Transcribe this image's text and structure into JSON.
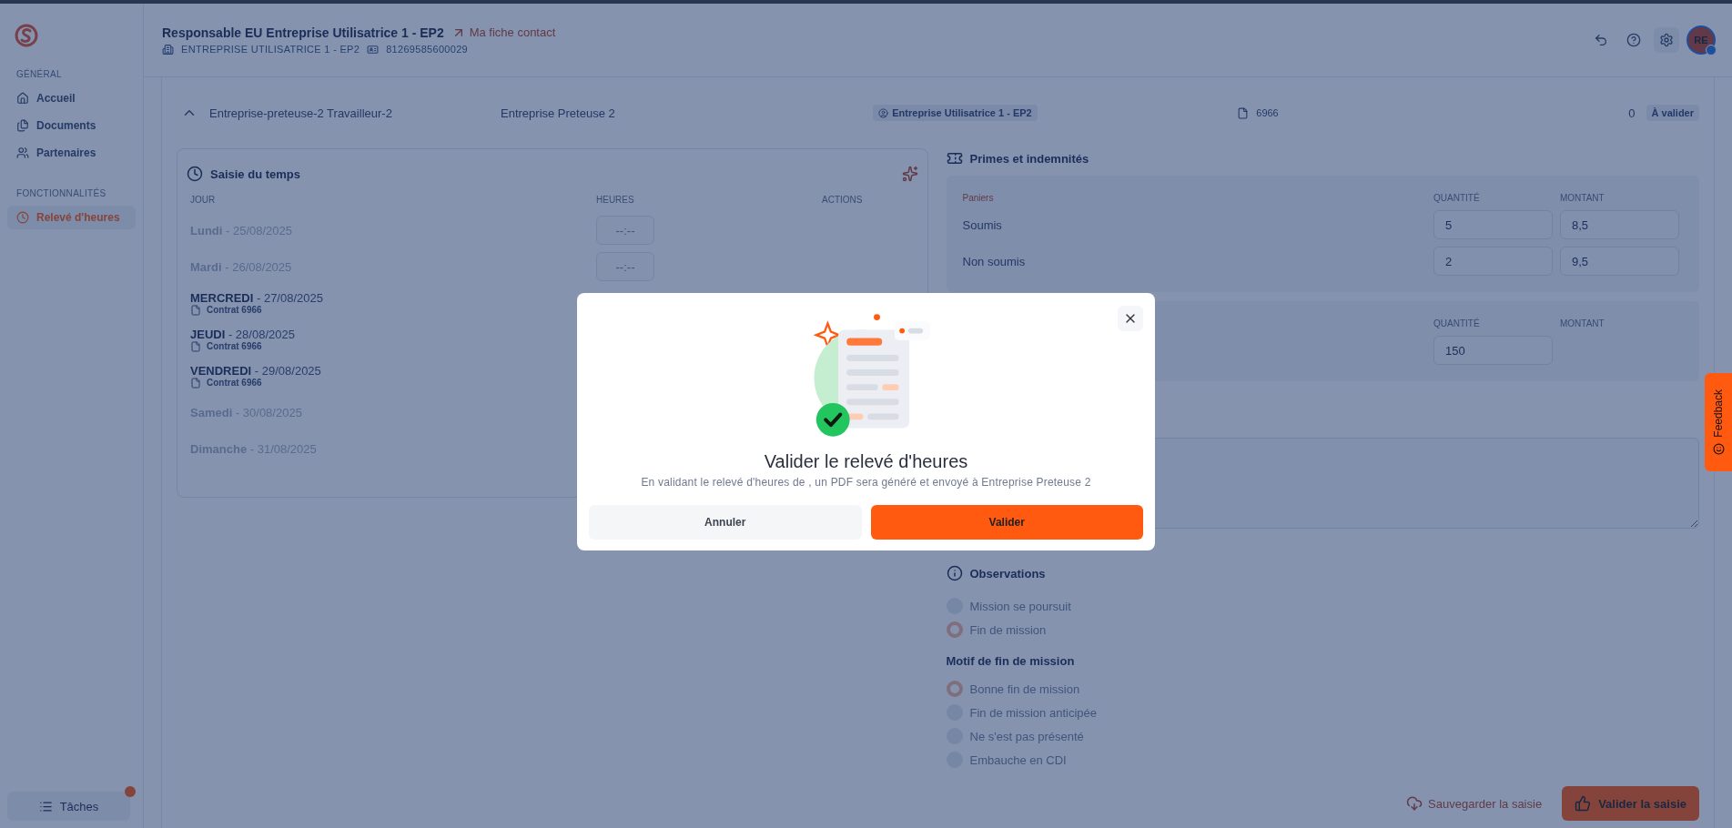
{
  "sidebar": {
    "sections": [
      {
        "title": "GÉNÉRAL",
        "items": [
          {
            "label": "Accueil",
            "selected": false
          },
          {
            "label": "Documents",
            "selected": false
          },
          {
            "label": "Partenaires",
            "selected": false
          }
        ]
      },
      {
        "title": "FONCTIONNALITÉS",
        "items": [
          {
            "label": "Relevé d'heures",
            "selected": true
          }
        ]
      }
    ],
    "tasks": {
      "label": "Tâches",
      "notification": true
    }
  },
  "header": {
    "title": "Responsable EU Entreprise Utilisatrice 1 - EP2",
    "contact_link": "Ma fiche contact",
    "company": "ENTREPRISE UTILISATRICE 1 - EP2",
    "siret": "81269585600029",
    "avatar": "RE"
  },
  "timesheet_row": {
    "expanded": true,
    "worker": "Entreprise-preteuse-2 Travailleur-2",
    "agency": "Entreprise Preteuse 2",
    "client": "Entreprise Utilisatrice 1 - EP2",
    "contract": "6966",
    "count": "0",
    "status": "À valider"
  },
  "time_entry": {
    "title": "Saisie du temps",
    "columns": [
      "JOUR",
      "HEURES",
      "ACTIONS"
    ],
    "days": [
      {
        "day": "Lundi",
        "date": "- 25/08/2025",
        "disabled": true,
        "hours_placeholder": "--:--"
      },
      {
        "day": "Mardi",
        "date": "- 26/08/2025",
        "disabled": true,
        "hours_placeholder": "--:--"
      },
      {
        "day": "MERCREDI",
        "date": "- 27/08/2025",
        "disabled": false,
        "contract": "Contrat 6966"
      },
      {
        "day": "JEUDI",
        "date": "- 28/08/2025",
        "disabled": false,
        "contract": "Contrat 6966"
      },
      {
        "day": "VENDREDI",
        "date": "- 29/08/2025",
        "disabled": false,
        "contract": "Contrat 6966"
      },
      {
        "day": "Samedi",
        "date": "- 30/08/2025",
        "disabled": true
      },
      {
        "day": "Dimanche",
        "date": "- 31/08/2025",
        "disabled": true
      }
    ]
  },
  "allowances": {
    "title": "Primes et indemnités",
    "groups": [
      {
        "label": "Paniers",
        "columns": [
          "QUANTITÉ",
          "MONTANT"
        ],
        "rows": [
          {
            "label": "Soumis",
            "quantity": "5",
            "amount": "8,5"
          },
          {
            "label": "Non soumis",
            "quantity": "2",
            "amount": "9,5"
          }
        ]
      },
      {
        "columns": [
          "QUANTITÉ",
          "MONTANT"
        ],
        "rows": [
          {
            "quantity": "150"
          }
        ]
      }
    ]
  },
  "observations": {
    "title": "Observations",
    "options": [
      {
        "label": "Mission se poursuit",
        "selected": false
      },
      {
        "label": "Fin de mission",
        "selected": true
      }
    ]
  },
  "end_reason": {
    "title": "Motif de fin de mission",
    "options": [
      {
        "label": "Bonne fin de mission",
        "selected": true
      },
      {
        "label": "Fin de mission anticipée",
        "selected": false
      },
      {
        "label": "Ne s'est pas présenté",
        "selected": false
      },
      {
        "label": "Embauche en CDI",
        "selected": false
      }
    ]
  },
  "actions": {
    "save": "Sauvegarder la saisie",
    "validate": "Valider la saisie"
  },
  "feedback": "Feedback",
  "modal": {
    "title": "Valider le relevé d'heures",
    "message": "En validant le relevé d'heures de , un PDF sera généré et envoyé à Entreprise Preteuse 2",
    "buttons": [
      {
        "label": "Annuler",
        "kind": "secondary"
      },
      {
        "label": "Valider",
        "kind": "primary"
      }
    ]
  }
}
